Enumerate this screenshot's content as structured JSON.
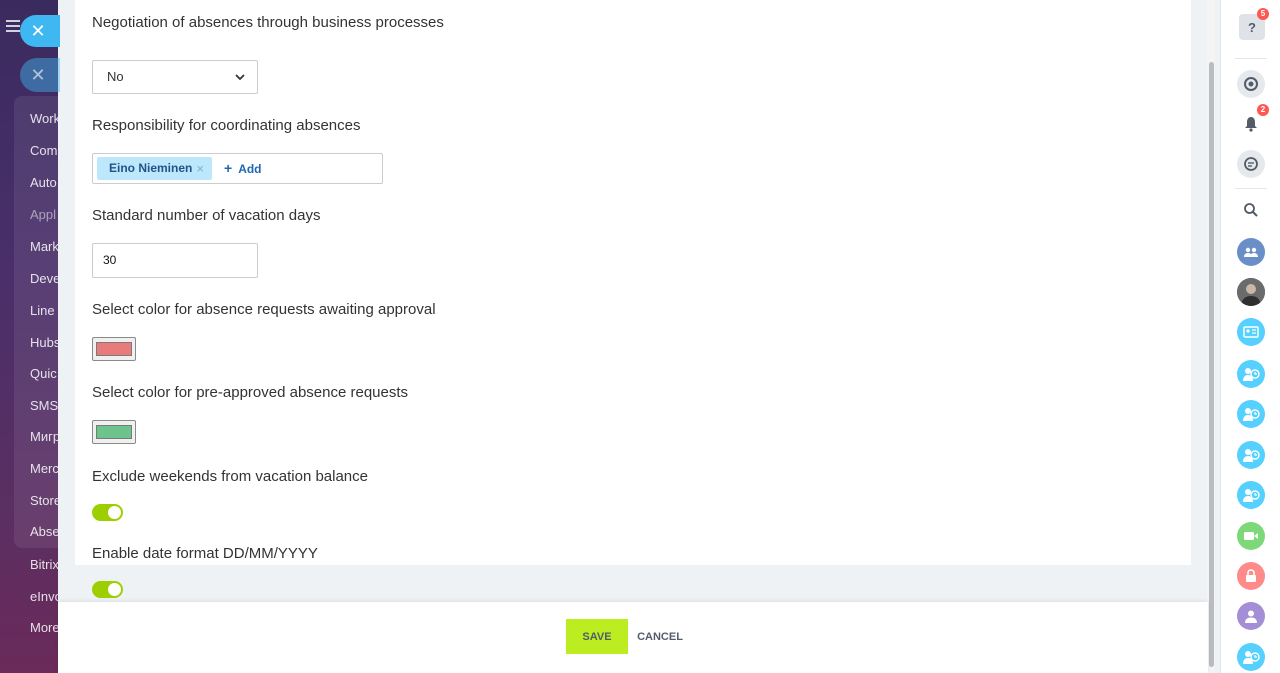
{
  "colors": {
    "accent": "#bbed21",
    "toggle_on": "#9dcf00",
    "pending_color": "#e87c7c",
    "preapproved_color": "#6cc48c",
    "tag_bg": "#bde8fb",
    "link": "#2067b0"
  },
  "left_menu": {
    "items": [
      "Work",
      "Com",
      "Auto",
      "Appl",
      "Mark",
      "Deve",
      "Line",
      "Hubs",
      "Quic",
      "SMS",
      "Мигр",
      "Merc",
      "Store",
      "Abse",
      "Bitrix",
      "eInvo",
      "More"
    ]
  },
  "settings": {
    "negotiation": {
      "label": "Negotiation of absences through business processes",
      "value": "No"
    },
    "responsibility": {
      "label": "Responsibility for coordinating absences",
      "person": "Eino Nieminen",
      "remove_glyph": "×",
      "add_label": "Add"
    },
    "vacation_days": {
      "label": "Standard number of vacation days",
      "value": "30"
    },
    "pending_color": {
      "label": "Select color for absence requests awaiting approval"
    },
    "preapproved_color": {
      "label": "Select color for pre-approved absence requests"
    },
    "exclude_weekends": {
      "label": "Exclude weekends from vacation balance",
      "enabled": true
    },
    "date_format": {
      "label": "Enable date format DD/MM/YYYY",
      "enabled": true
    }
  },
  "footer": {
    "save_label": "SAVE",
    "cancel_label": "CANCEL"
  },
  "right_bar": {
    "help_badge": "5",
    "notifications_badge": "2",
    "icons": [
      "help-icon",
      "copilot-icon",
      "bell-icon",
      "chat-icon",
      "search-icon",
      "group-chat-icon",
      "user-avatar",
      "contact-card-icon",
      "user-clock-icon",
      "user-clock-icon",
      "user-clock-icon",
      "user-clock-icon",
      "video-icon",
      "lock-icon",
      "user-icon",
      "user-clock-icon"
    ]
  }
}
